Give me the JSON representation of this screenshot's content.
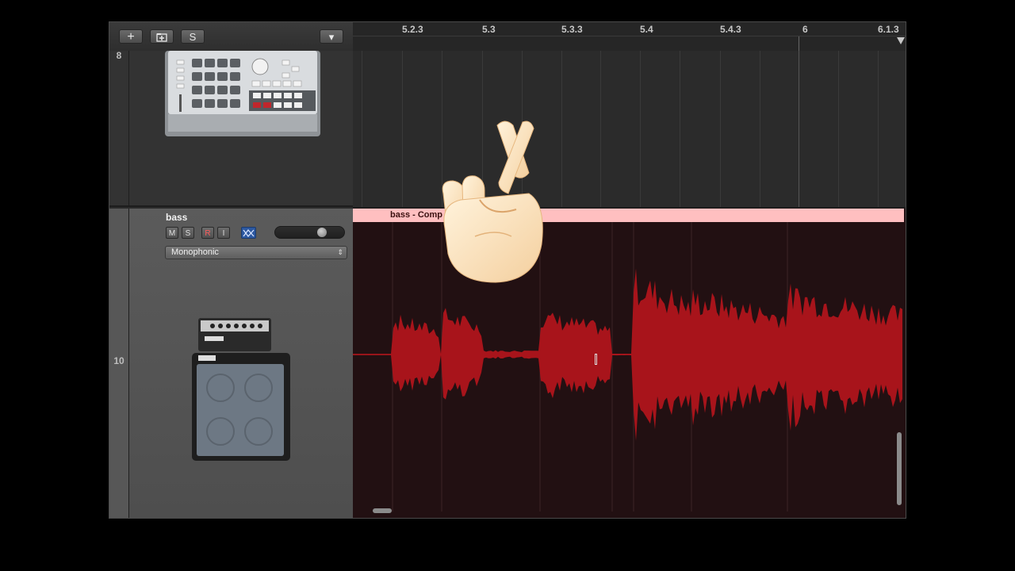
{
  "toolbar": {
    "add_label": "+",
    "folder_label": "+",
    "solo_label": "S",
    "menu_label": "▾"
  },
  "ruler": {
    "ticks": [
      "5.2.3",
      "5.3",
      "5.3.3",
      "5.4",
      "5.4.3",
      "6",
      "6.1.3"
    ]
  },
  "tracks": [
    {
      "number": "8",
      "icon": "drum-machine-icon"
    },
    {
      "number": "10",
      "name": "bass",
      "buttons": {
        "mute": "M",
        "solo": "S",
        "record": "R",
        "input": "I"
      },
      "mode": "Monophonic",
      "icon": "bass-amp-icon",
      "region_name": "bass - Comp"
    }
  ],
  "overlay": {
    "icon": "crossed-fingers-icon"
  },
  "colors": {
    "region_header": "#ffbfc0",
    "waveform": "#b3141c",
    "lane_background": "#221012"
  }
}
